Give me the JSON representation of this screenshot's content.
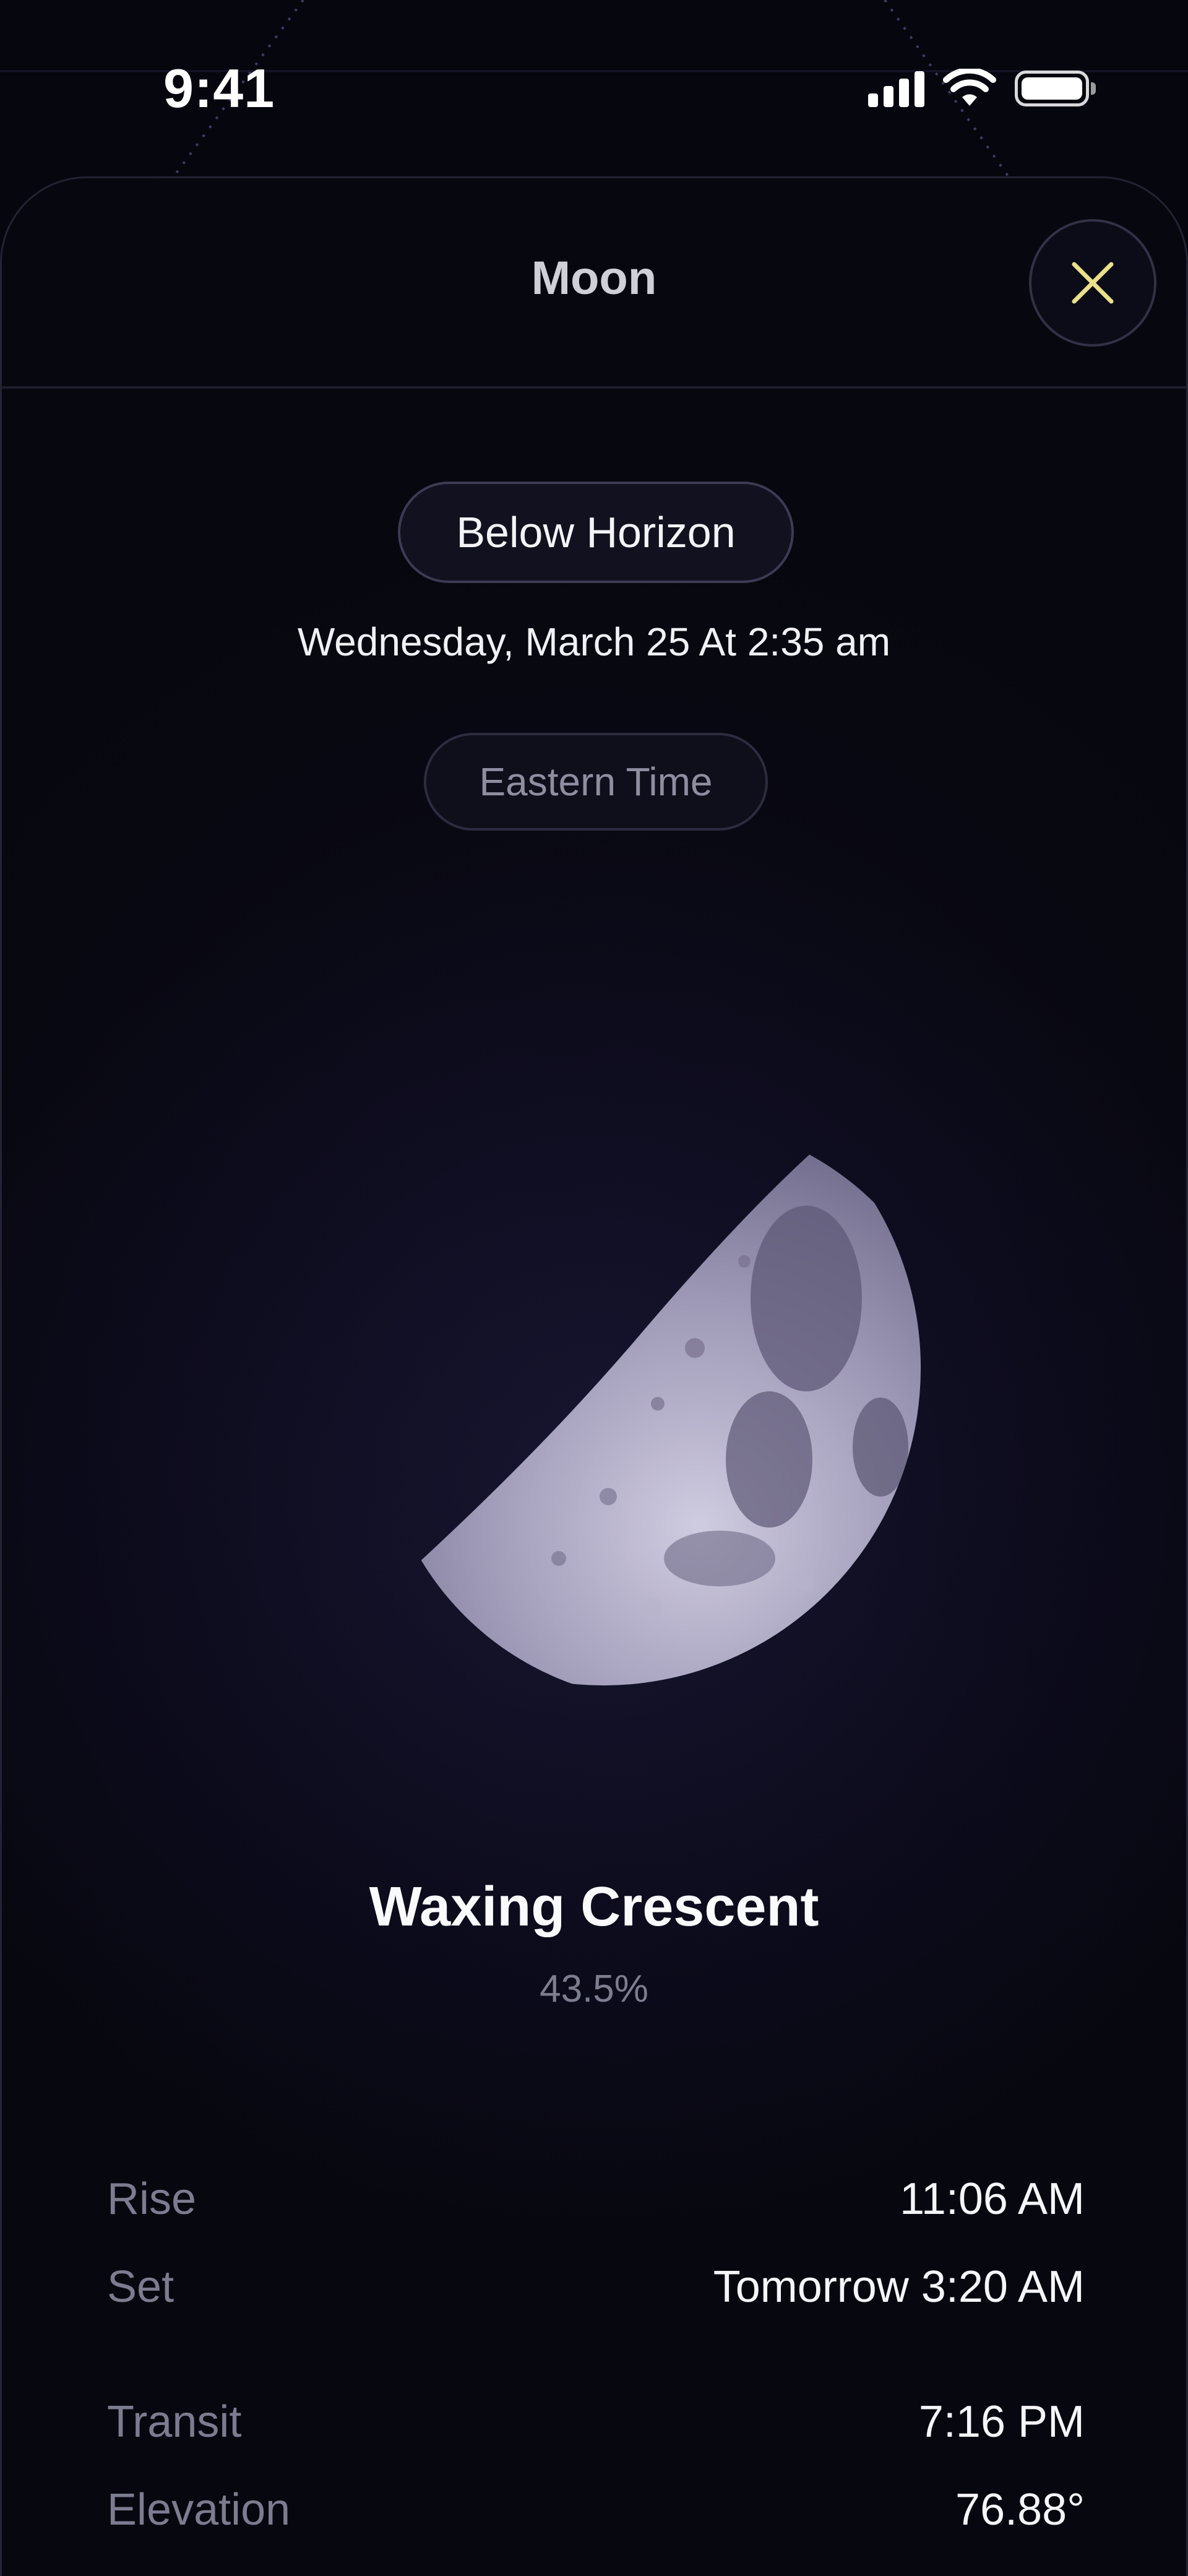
{
  "status_bar": {
    "time": "9:41"
  },
  "header": {
    "title": "Moon"
  },
  "visibility": {
    "label": "Below Horizon"
  },
  "datetime": "Wednesday, March 25 At 2:35 am",
  "timezone": {
    "label": "Eastern Time"
  },
  "phase": {
    "name": "Waxing Crescent",
    "illumination": "43.5%"
  },
  "details": [
    {
      "label": "Rise",
      "value": "11:06 AM"
    },
    {
      "label": "Set",
      "value": "Tomorrow 3:20 AM"
    },
    {
      "label": "Transit",
      "value": "7:16 PM"
    },
    {
      "label": "Elevation",
      "value": "76.88°"
    }
  ],
  "colors": {
    "accent": "#e9e08a",
    "background": "#06060e",
    "muted_text": "#7c7c90"
  },
  "icons": {
    "close": "close-icon",
    "signal": "cellular-signal-icon",
    "wifi": "wifi-icon",
    "battery": "battery-icon"
  }
}
